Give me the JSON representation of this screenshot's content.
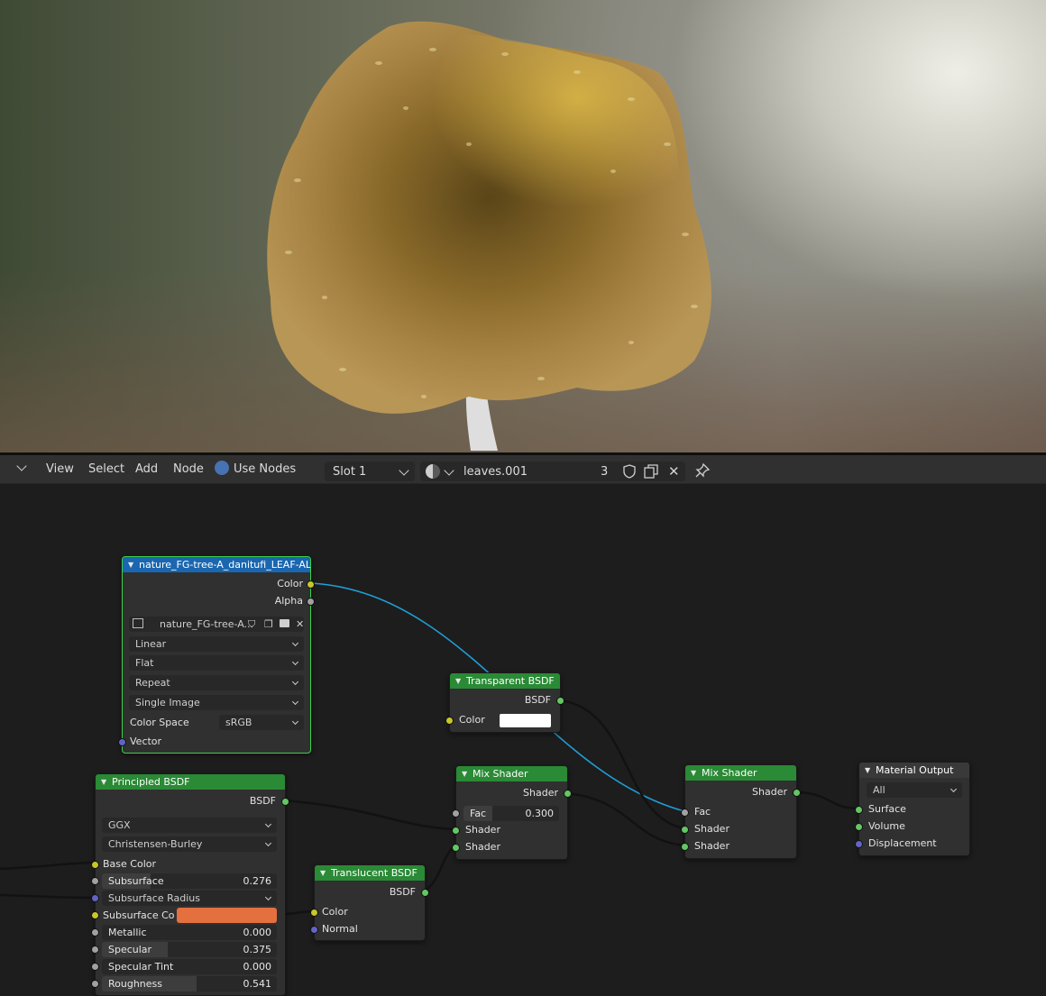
{
  "header": {
    "menus": [
      "View",
      "Select",
      "Add",
      "Node"
    ],
    "use_nodes_label": "Use Nodes",
    "slot": "Slot 1",
    "material_name": "leaves.001",
    "user_count": "3"
  },
  "nodes": {
    "image_texture": {
      "title": "nature_FG-tree-A_danitufi_LEAF-ALPHA....",
      "outputs": [
        "Color",
        "Alpha"
      ],
      "image_name": "nature_FG-tree-A...",
      "interpolation": "Linear",
      "projection": "Flat",
      "extension": "Repeat",
      "source": "Single Image",
      "color_space_label": "Color Space",
      "color_space": "sRGB",
      "input_vector": "Vector"
    },
    "transparent_bsdf": {
      "title": "Transparent BSDF",
      "output": "BSDF",
      "input_color": "Color",
      "color_value": "#ffffff"
    },
    "principled_bsdf": {
      "title": "Principled BSDF",
      "output": "BSDF",
      "distribution": "GGX",
      "subsurface_method": "Christensen-Burley",
      "base_color_label": "Base Color",
      "subsurface_label": "Subsurface",
      "subsurface": "0.276",
      "subsurface_radius_label": "Subsurface Radius",
      "subsurface_color_label": "Subsurface Co",
      "subsurface_color": "#e4703f",
      "metallic_label": "Metallic",
      "metallic": "0.000",
      "specular_label": "Specular",
      "specular": "0.375",
      "specular_tint_label": "Specular Tint",
      "specular_tint": "0.000",
      "roughness_label": "Roughness",
      "roughness": "0.541"
    },
    "mix_shader_1": {
      "title": "Mix Shader",
      "output": "Shader",
      "fac_label": "Fac",
      "fac": "0.300",
      "inputs": [
        "Shader",
        "Shader"
      ]
    },
    "translucent_bsdf": {
      "title": "Translucent BSDF",
      "output": "BSDF",
      "inputs": [
        "Color",
        "Normal"
      ]
    },
    "mix_shader_2": {
      "title": "Mix Shader",
      "output": "Shader",
      "inputs": [
        "Fac",
        "Shader",
        "Shader"
      ]
    },
    "material_output": {
      "title": "Material Output",
      "target": "All",
      "inputs": [
        "Surface",
        "Volume",
        "Displacement"
      ]
    }
  },
  "colors": {
    "node_header_shader": "#2a8a35",
    "node_header_texture": "#1a66b0",
    "socket_color": "#c7c729",
    "socket_shader": "#63c763",
    "socket_float": "#a1a1a1",
    "socket_vector": "#6363c7",
    "selected_link": "#1f9ed6"
  }
}
